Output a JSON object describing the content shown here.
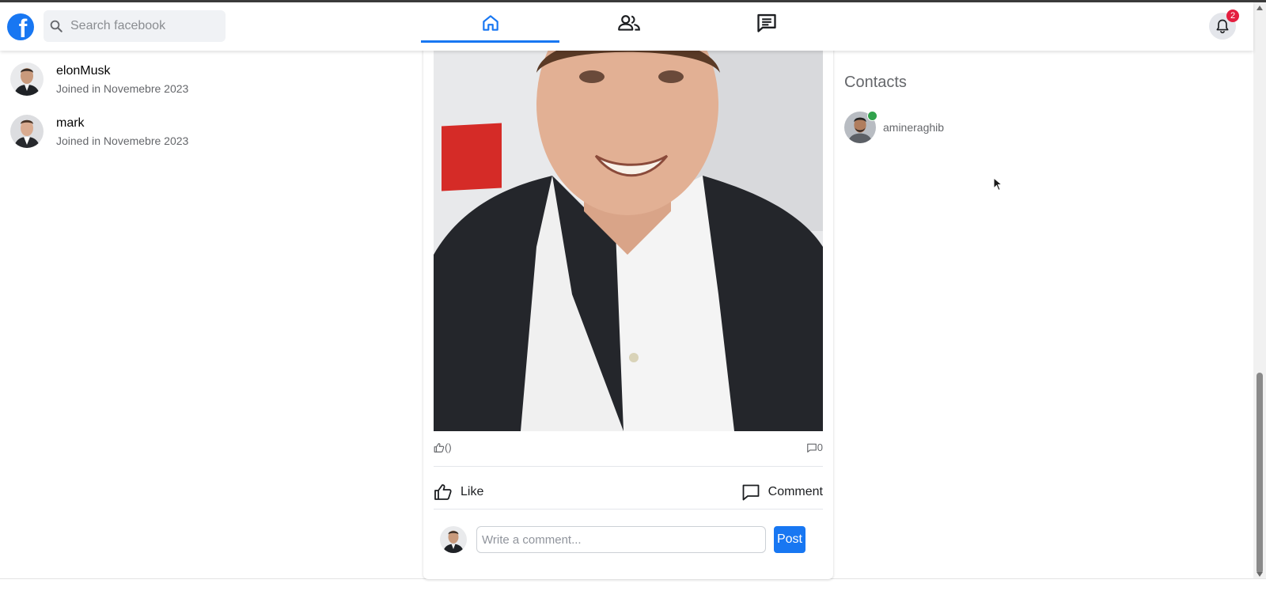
{
  "search": {
    "placeholder": "Search facebook"
  },
  "logo": {
    "letter": "f"
  },
  "nav": {
    "tabs": [
      {
        "name": "home",
        "icon": "home-icon",
        "active": true
      },
      {
        "name": "friends",
        "icon": "friends-icon",
        "active": false
      },
      {
        "name": "messages",
        "icon": "message-icon",
        "active": false
      }
    ]
  },
  "notifications": {
    "count": "2"
  },
  "users": [
    {
      "name": "elonMusk",
      "joined": "Joined in Novemebre 2023"
    },
    {
      "name": "mark",
      "joined": "Joined in Novemebre 2023"
    }
  ],
  "post": {
    "likes_count": "()",
    "comments_count": "0",
    "like_label": "Like",
    "comment_label": "Comment",
    "comment_placeholder": "Write a comment...",
    "post_button": "Post"
  },
  "contacts": {
    "title": "Contacts",
    "items": [
      {
        "name": "amineraghib",
        "online": true
      }
    ]
  },
  "colors": {
    "brand": "#1877f2",
    "online": "#31a24c",
    "badge": "#e41e3f"
  }
}
